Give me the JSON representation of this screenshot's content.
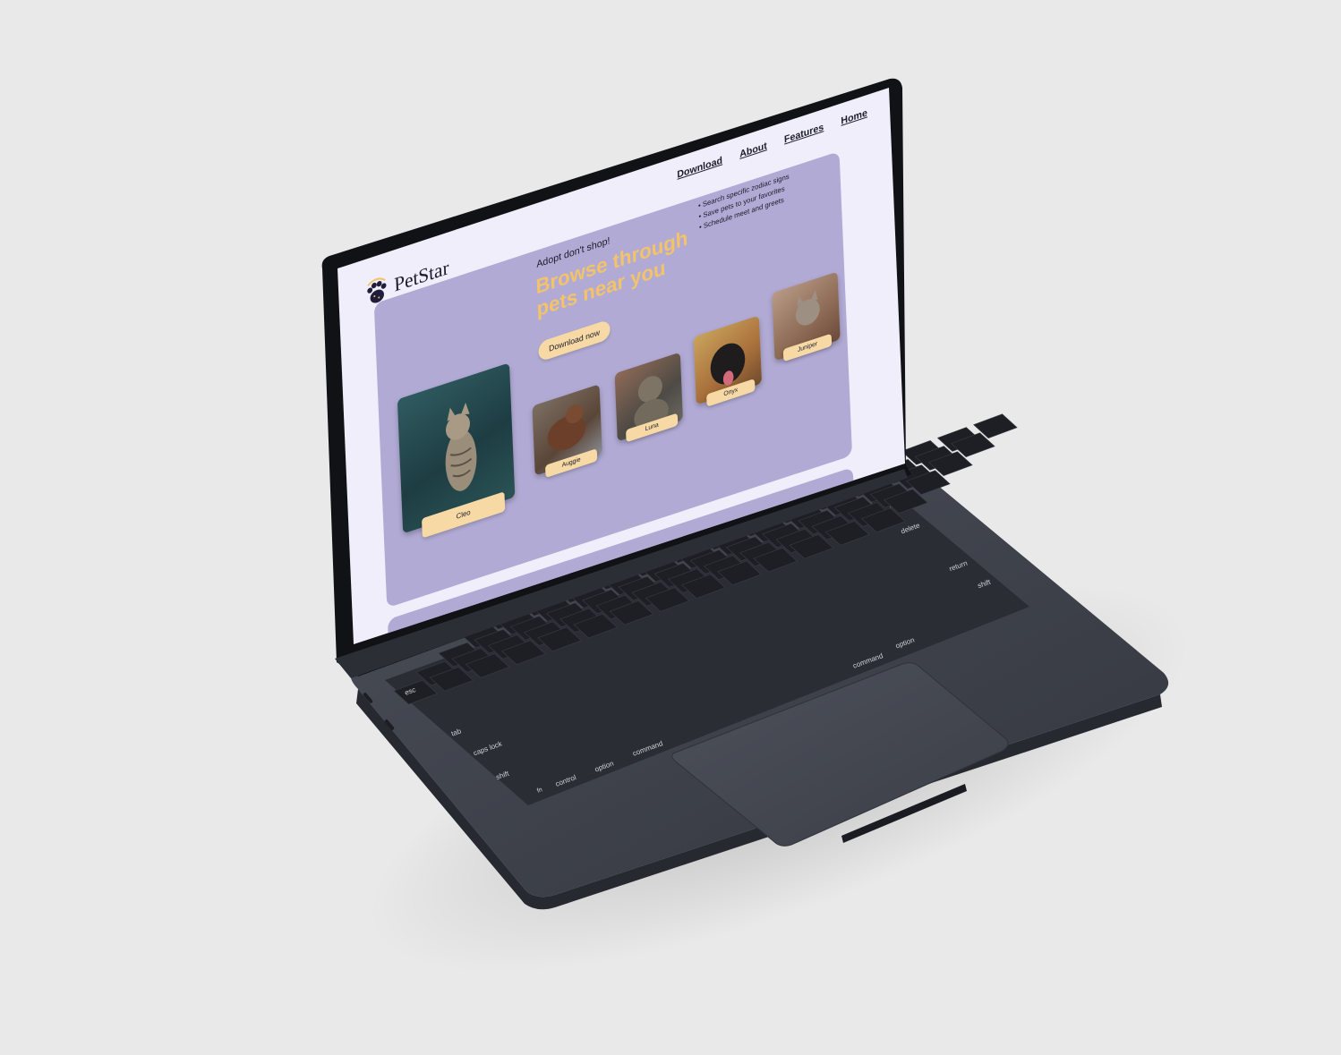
{
  "site": {
    "brand": "PetStar",
    "nav": [
      "Download",
      "About",
      "Features",
      "Home"
    ],
    "tagline": "Adopt don't shop!",
    "headline": "Browse through pets near you",
    "features": [
      "Search specific zodiac signs",
      "Save pets to your favorites",
      "Schedule meet and greets"
    ],
    "cta": "Download now",
    "pets": [
      {
        "name": "Cleo"
      },
      {
        "name": "Auggie"
      },
      {
        "name": "Luna"
      },
      {
        "name": "Onyx"
      },
      {
        "name": "Juniper"
      }
    ]
  },
  "keyboard": {
    "esc": "esc",
    "tab": "tab",
    "caps": "caps lock",
    "shift_left": "shift",
    "shift_right": "shift",
    "fn": "fn",
    "control": "control",
    "option_left": "option",
    "option_right": "option",
    "command_left": "command",
    "command_right": "command",
    "delete": "delete",
    "return": "return"
  },
  "colors": {
    "screen_bg": "#f1eefb",
    "hero": "#b1aad4",
    "accent": "#f3c36a",
    "label": "#f6d9a4",
    "laptop": "#3a3e47"
  }
}
